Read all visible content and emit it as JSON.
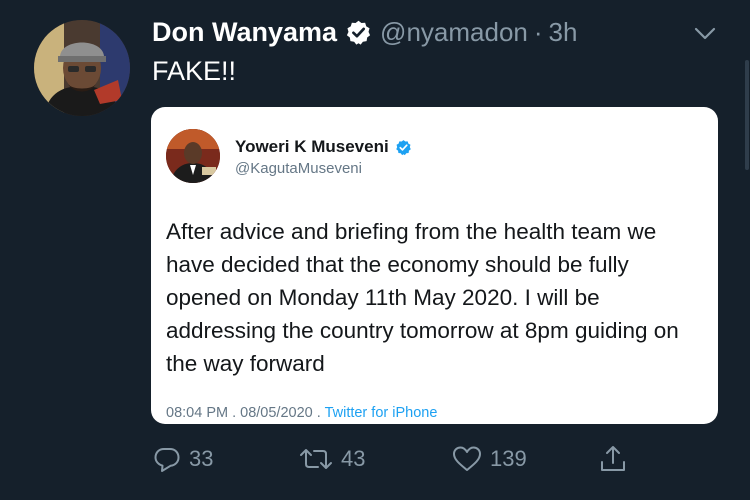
{
  "tweet": {
    "display_name": "Don Wanyama",
    "handle": "@nyamadon",
    "separator": "·",
    "time": "3h",
    "text": "FAKE!!",
    "avatar_icon": "profile-photo",
    "verified_icon": "verified-badge-icon",
    "more_icon": "chevron-down-icon"
  },
  "quoted": {
    "display_name": "Yoweri K Museveni",
    "handle": "@KagutaMuseveni",
    "text": "After advice and briefing from the health team we have decided that the economy should be fully opened on Monday 11th May 2020. I will be addressing the country tomorrow at 8pm guiding on the way forward",
    "timestamp": "08:04 PM . 08/05/2020 .",
    "source": "Twitter for iPhone"
  },
  "actions": {
    "replies": "33",
    "retweets": "43",
    "likes": "139",
    "reply_icon": "reply-icon",
    "retweet_icon": "retweet-icon",
    "like_icon": "heart-icon",
    "share_icon": "share-icon"
  },
  "colors": {
    "background": "#15202b",
    "muted": "#8899a6",
    "accent": "#1da1f2",
    "card": "#ffffff"
  }
}
